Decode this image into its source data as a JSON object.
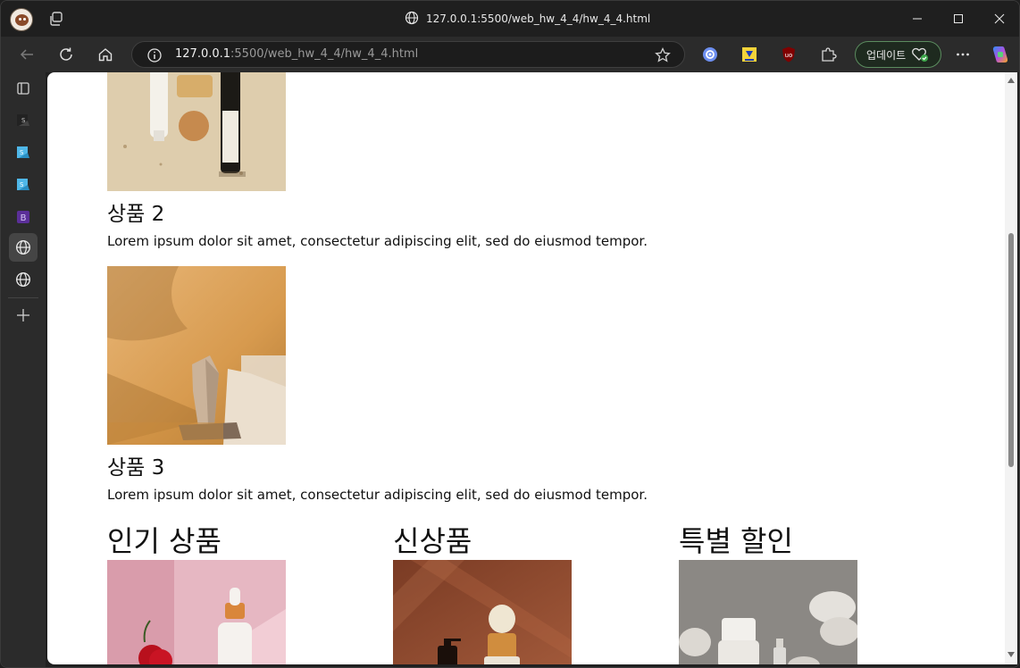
{
  "browser": {
    "tab_title": "127.0.0.1:5500/web_hw_4_4/hw_4_4.html",
    "url_host": "127.0.0.1",
    "url_rest": ":5500/web_hw_4_4/hw_4_4.html",
    "update_label": "업데이트",
    "icons": {
      "profile": "profile-avatar-icon",
      "tabs": "tab-actions-icon",
      "globe": "globe-icon",
      "back": "back-arrow-icon",
      "refresh": "refresh-icon",
      "home": "home-icon",
      "info": "site-info-icon",
      "favorite": "star-icon",
      "more": "more-icon",
      "copilot": "copilot-icon"
    }
  },
  "sidebar": {
    "items": [
      {
        "name": "vertical-tabs",
        "letter": ""
      },
      {
        "name": "stackedit-s-dark",
        "letter": "S"
      },
      {
        "name": "stackedit-s-blue-1",
        "letter": "S"
      },
      {
        "name": "stackedit-s-blue-2",
        "letter": "S"
      },
      {
        "name": "bootstrap",
        "letter": "B"
      },
      {
        "name": "globe-active",
        "letter": ""
      },
      {
        "name": "globe",
        "letter": ""
      }
    ],
    "add_label": "+"
  },
  "page": {
    "products": [
      {
        "title": "상품 2",
        "desc": "Lorem ipsum dolor sit amet, consectetur adipiscing elit, sed do eiusmod tempor."
      },
      {
        "title": "상품 3",
        "desc": "Lorem ipsum dolor sit amet, consectetur adipiscing elit, sed do eiusmod tempor."
      }
    ],
    "sections": [
      {
        "title": "인기 상품"
      },
      {
        "title": "신상품"
      },
      {
        "title": "특별 할인"
      }
    ]
  },
  "colors": {
    "chrome_bg": "#1f1f1f",
    "toolbar_bg": "#2b2b2b",
    "page_bg": "#ffffff",
    "update_border": "#5b8c5f"
  }
}
